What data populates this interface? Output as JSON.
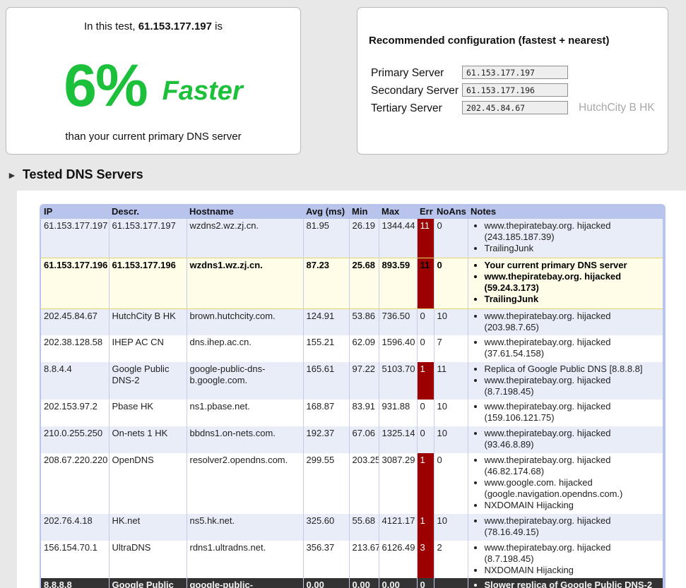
{
  "summary": {
    "intro_prefix": "In this test,",
    "ip": "61.153.177.197",
    "intro_suffix": "is",
    "percent": "6%",
    "faster": "Faster",
    "than": "than your current primary DNS server"
  },
  "config": {
    "title": "Recommended configuration (fastest + nearest)",
    "primary_label": "Primary Server",
    "primary_value": "61.153.177.197",
    "secondary_label": "Secondary Server",
    "secondary_value": "61.153.177.196",
    "tertiary_label": "Tertiary Server",
    "tertiary_value": "202.45.84.67",
    "tertiary_desc": "HutchCity B HK"
  },
  "section": {
    "title": "Tested DNS Servers",
    "arrow": "►"
  },
  "table": {
    "headers": [
      "IP",
      "Descr.",
      "Hostname",
      "Avg (ms)",
      "Min",
      "Max",
      "Err",
      "NoAns",
      "Notes"
    ],
    "rows": [
      {
        "ip": "61.153.177.197",
        "descr": "61.153.177.197",
        "host": "wzdns2.wz.zj.cn.",
        "avg": "81.95",
        "min": "26.19",
        "max": "1344.44",
        "err": "11",
        "noans": "0",
        "err_red": true,
        "style": "odd",
        "notes": [
          "www.thepiratebay.org. hijacked (243.185.187.39)",
          "TrailingJunk"
        ]
      },
      {
        "ip": "61.153.177.196",
        "descr": "61.153.177.196",
        "host": "wzdns1.wz.zj.cn.",
        "avg": "87.23",
        "min": "25.68",
        "max": "893.59",
        "err": "11",
        "noans": "0",
        "err_red": true,
        "style": "current",
        "notes": [
          "Your current primary DNS server",
          "www.thepiratebay.org. hijacked (59.24.3.173)",
          "TrailingJunk"
        ]
      },
      {
        "ip": "202.45.84.67",
        "descr": "HutchCity B HK",
        "host": "brown.hutchcity.com.",
        "avg": "124.91",
        "min": "53.86",
        "max": "736.50",
        "err": "0",
        "noans": "10",
        "err_red": false,
        "style": "odd",
        "notes": [
          "www.thepiratebay.org. hijacked (203.98.7.65)"
        ]
      },
      {
        "ip": "202.38.128.58",
        "descr": "IHEP AC CN",
        "host": "dns.ihep.ac.cn.",
        "avg": "155.21",
        "min": "62.09",
        "max": "1596.40",
        "err": "0",
        "noans": "7",
        "err_red": false,
        "style": "even",
        "notes": [
          "www.thepiratebay.org. hijacked (37.61.54.158)"
        ]
      },
      {
        "ip": "8.8.4.4",
        "descr": "Google Public DNS-2",
        "host": "google-public-dns-b.google.com.",
        "avg": "165.61",
        "min": "97.22",
        "max": "5103.70",
        "err": "1",
        "noans": "11",
        "err_red": true,
        "style": "odd",
        "notes": [
          "Replica of Google Public DNS [8.8.8.8]",
          "www.thepiratebay.org. hijacked (8.7.198.45)"
        ]
      },
      {
        "ip": "202.153.97.2",
        "descr": "Pbase HK",
        "host": "ns1.pbase.net.",
        "avg": "168.87",
        "min": "83.91",
        "max": "931.88",
        "err": "0",
        "noans": "10",
        "err_red": false,
        "style": "even",
        "notes": [
          "www.thepiratebay.org. hijacked (159.106.121.75)"
        ]
      },
      {
        "ip": "210.0.255.250",
        "descr": "On-nets 1 HK",
        "host": "bbdns1.on-nets.com.",
        "avg": "192.37",
        "min": "67.06",
        "max": "1325.14",
        "err": "0",
        "noans": "10",
        "err_red": false,
        "style": "odd",
        "notes": [
          "www.thepiratebay.org. hijacked (93.46.8.89)"
        ]
      },
      {
        "ip": "208.67.220.220",
        "descr": "OpenDNS",
        "host": "resolver2.opendns.com.",
        "avg": "299.55",
        "min": "203.25",
        "max": "3087.29",
        "err": "1",
        "noans": "0",
        "err_red": true,
        "style": "even",
        "notes": [
          "www.thepiratebay.org. hijacked (46.82.174.68)",
          "www.google.com. hijacked (google.navigation.opendns.com.)",
          "NXDOMAIN Hijacking"
        ]
      },
      {
        "ip": "202.76.4.18",
        "descr": "HK.net",
        "host": "ns5.hk.net.",
        "avg": "325.60",
        "min": "55.68",
        "max": "4121.17",
        "err": "1",
        "noans": "10",
        "err_red": true,
        "style": "odd",
        "notes": [
          "www.thepiratebay.org. hijacked (78.16.49.15)"
        ]
      },
      {
        "ip": "156.154.70.1",
        "descr": "UltraDNS",
        "host": "rdns1.ultradns.net.",
        "avg": "356.37",
        "min": "213.67",
        "max": "6126.49",
        "err": "3",
        "noans": "2",
        "err_red": true,
        "style": "even",
        "notes": [
          "www.thepiratebay.org. hijacked (8.7.198.45)",
          "NXDOMAIN Hijacking"
        ]
      },
      {
        "ip": "8.8.8.8",
        "descr": "Google Public",
        "host": "google-public-",
        "avg": "0.00",
        "min": "0.00",
        "max": "0.00",
        "err": "0",
        "noans": "",
        "err_red": false,
        "style": "dark",
        "notes": [
          "Slower replica of Google Public DNS-2"
        ]
      }
    ]
  }
}
